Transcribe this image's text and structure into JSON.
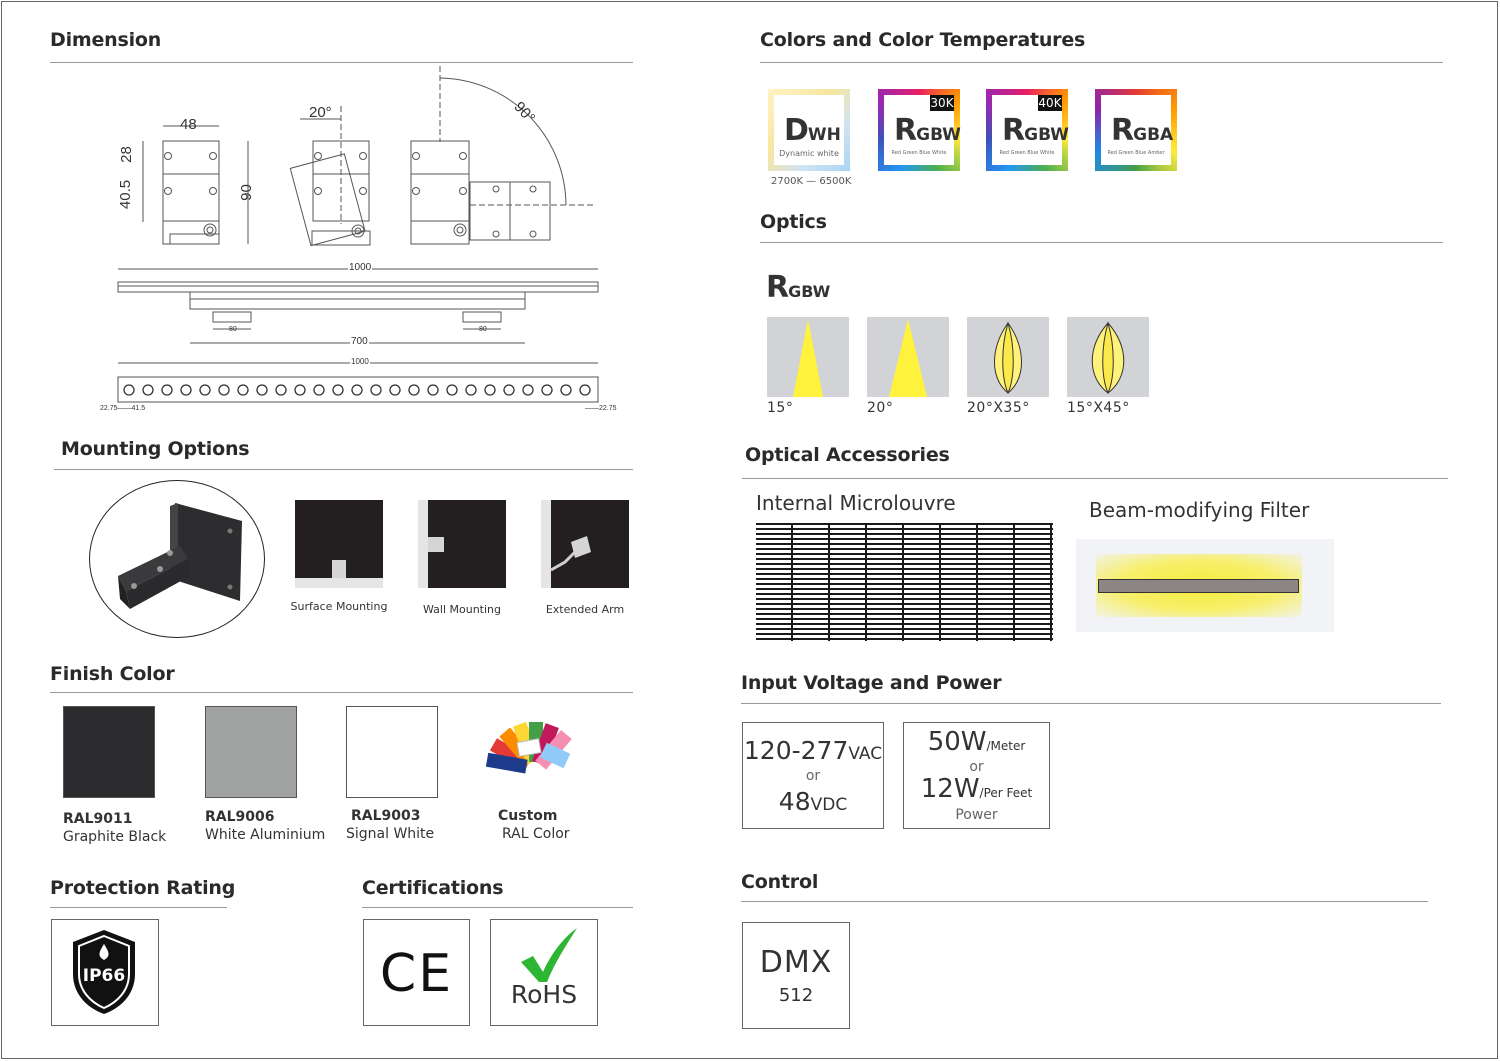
{
  "sections": {
    "dimension": "Dimension",
    "colors": "Colors and Color Temperatures",
    "optics": "Optics",
    "mounting": "Mounting Options",
    "optical_accessories": "Optical Accessories",
    "finish": "Finish Color",
    "input": "Input Voltage and Power",
    "protection": "Protection Rating",
    "certifications": "Certifications",
    "control": "Control"
  },
  "dimension": {
    "w48": "48",
    "angle20": "20°",
    "angle90": "90°",
    "h28": "28",
    "h40_5": "40.5",
    "h90": "90",
    "len1000_top": "1000",
    "len700": "700",
    "len80_a": "80",
    "len80_b": "80",
    "len1000_bottom": "1000",
    "left_spacing": "22.75——41.5",
    "right_spacing": "——22.75"
  },
  "colors": {
    "items": [
      {
        "big": "D",
        "small": "WH",
        "sub": "Dynamic white",
        "tag": "",
        "caption": "2700K — 6500K"
      },
      {
        "big": "R",
        "small": "GBW",
        "sub": "Red Green Blue White",
        "tag": "30K",
        "caption": ""
      },
      {
        "big": "R",
        "small": "GBW",
        "sub": "Red Green Blue White",
        "tag": "40K",
        "caption": ""
      },
      {
        "big": "R",
        "small": "GBA",
        "sub": "Red Green Blue Amber",
        "tag": "",
        "caption": ""
      }
    ]
  },
  "optics": {
    "big": "R",
    "small": "GBW",
    "beams": [
      "15°",
      "20°",
      "20°X35°",
      "15°X45°"
    ]
  },
  "mounting": {
    "options": [
      "Surface Mounting",
      "Wall Mounting",
      "Extended Arm"
    ]
  },
  "accessories": {
    "louvre": "Internal Microlouvre",
    "filter": "Beam-modifying Filter"
  },
  "finish": {
    "items": [
      {
        "code": "RAL9011",
        "name": "Graphite Black",
        "color": "#2b2b2d"
      },
      {
        "code": "RAL9006",
        "name": "White Aluminium",
        "color": "#a1a2a2"
      },
      {
        "code": "RAL9003",
        "name": "Signal White",
        "color": "#ffffff"
      },
      {
        "code": "Custom",
        "name": "RAL Color",
        "color": ""
      }
    ]
  },
  "input": {
    "voltage_ac": "120-277",
    "unit_ac": "VAC",
    "or1": "or",
    "voltage_dc": "48",
    "unit_dc": "VDC",
    "power_m": "50W",
    "unit_m": "/Meter",
    "or2": "or",
    "power_ft": "12W",
    "unit_ft": "/Per Feet",
    "power_label": "Power"
  },
  "protection": {
    "rating": "IP66"
  },
  "certifications": {
    "ce": "CE",
    "rohs": "RoHS"
  },
  "control": {
    "protocol": "DMX",
    "channels": "512"
  }
}
